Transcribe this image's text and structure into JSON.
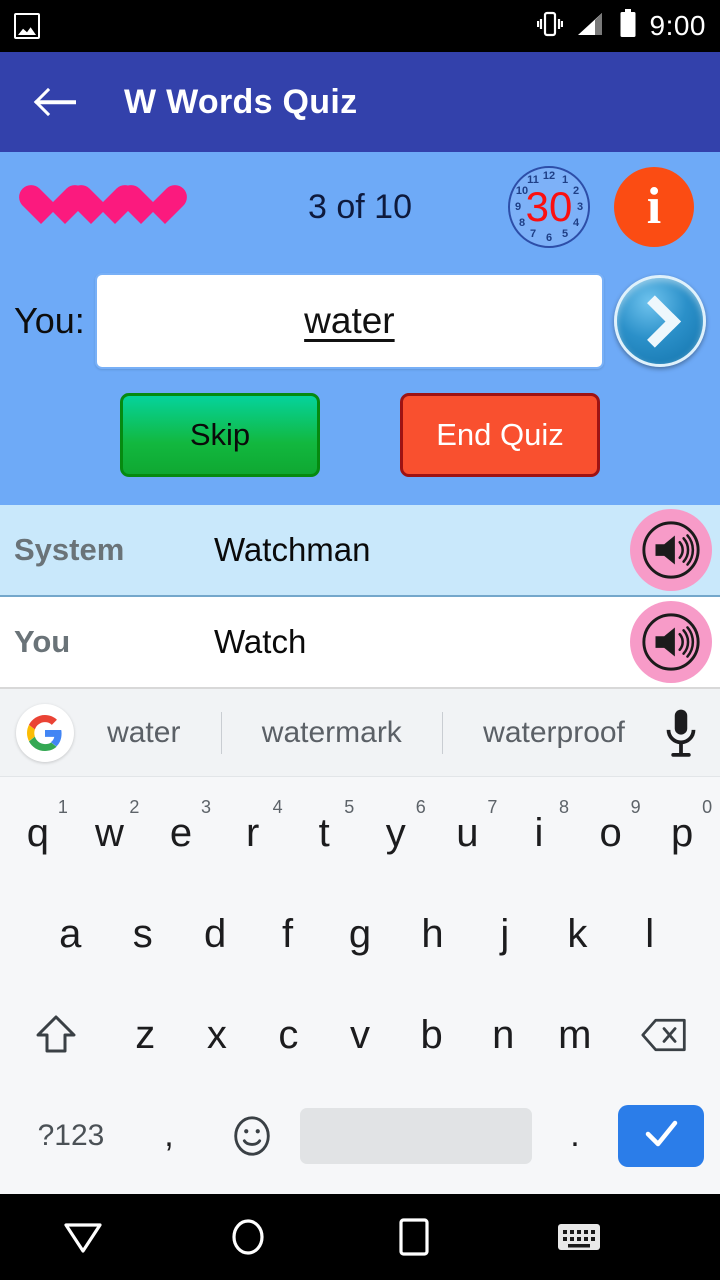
{
  "statusbar": {
    "time": "9:00",
    "icons": [
      "photo-icon",
      "vibrate-icon",
      "signal-icon",
      "battery-icon"
    ]
  },
  "appbar": {
    "back_icon": "back-arrow-icon",
    "title": "W Words Quiz",
    "background_color": "#3341ab"
  },
  "quiz": {
    "lives": 3,
    "heart_color": "#fb1a7e",
    "progress": "3 of 10",
    "timer": {
      "value": "30",
      "value_color": "#fb0f10",
      "ticks": [
        "12",
        "1",
        "2",
        "3",
        "4",
        "5",
        "6",
        "7",
        "8",
        "9",
        "10",
        "11"
      ]
    },
    "info_label": "i",
    "info_color": "#fb4c13",
    "you_label": "You:",
    "answer_value": "water",
    "answer_placeholder": "",
    "next_icon": "chevron-right-icon",
    "skip_label": "Skip",
    "end_label": "End Quiz",
    "panel_color": "#6eaaf7"
  },
  "history": [
    {
      "who": "System",
      "word": "Watchman",
      "speaker_icon": "speaker-icon"
    },
    {
      "who": "You",
      "word": "Watch",
      "speaker_icon": "speaker-icon"
    }
  ],
  "keyboard": {
    "suggestions": [
      "water",
      "watermark",
      "waterproof"
    ],
    "google_icon": "google-logo-icon",
    "mic_icon": "microphone-icon",
    "row1": [
      {
        "letter": "q",
        "num": "1"
      },
      {
        "letter": "w",
        "num": "2"
      },
      {
        "letter": "e",
        "num": "3"
      },
      {
        "letter": "r",
        "num": "4"
      },
      {
        "letter": "t",
        "num": "5"
      },
      {
        "letter": "y",
        "num": "6"
      },
      {
        "letter": "u",
        "num": "7"
      },
      {
        "letter": "i",
        "num": "8"
      },
      {
        "letter": "o",
        "num": "9"
      },
      {
        "letter": "p",
        "num": "0"
      }
    ],
    "row2": [
      "a",
      "s",
      "d",
      "f",
      "g",
      "h",
      "j",
      "k",
      "l"
    ],
    "row3": [
      "z",
      "x",
      "c",
      "v",
      "b",
      "n",
      "m"
    ],
    "shift_icon": "shift-icon",
    "backspace_icon": "backspace-icon",
    "symbols_label": "?123",
    "comma_label": ",",
    "emoji_icon": "emoji-icon",
    "space_label": "",
    "period_label": ".",
    "enter_icon": "checkmark-icon",
    "enter_color": "#2b7de9"
  },
  "navbar": {
    "back_icon": "nav-back-triangle-icon",
    "home_icon": "nav-home-circle-icon",
    "recents_icon": "nav-recents-square-icon",
    "keyboard_icon": "nav-keyboard-icon"
  }
}
